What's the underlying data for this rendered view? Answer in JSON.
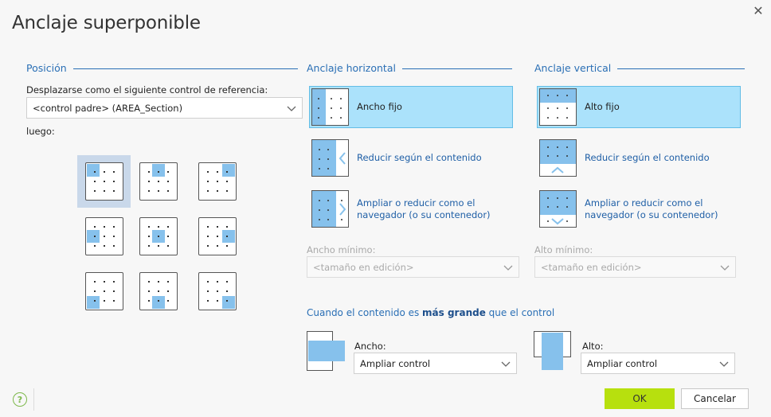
{
  "dialog": {
    "title": "Anclaje superponible",
    "close_symbol": "✕"
  },
  "position": {
    "header": "Posición",
    "ref_label": "Desplazarse como el siguiente control de referencia:",
    "ref_value": "<control padre> (AREA_Section)",
    "then_label": "luego:",
    "selected_index": 0
  },
  "horizontal": {
    "header": "Anclaje horizontal",
    "options": [
      {
        "label": "Ancho fijo",
        "selected": true
      },
      {
        "label": "Reducir según el contenido",
        "selected": false
      },
      {
        "label": "Ampliar o reducir como el navegador (o su contenedor)",
        "selected": false
      }
    ],
    "min_label": "Ancho mínimo:",
    "min_value": "<tamaño en edición>"
  },
  "vertical": {
    "header": "Anclaje vertical",
    "options": [
      {
        "label": "Alto fijo",
        "selected": true
      },
      {
        "label": "Reducir según el contenido",
        "selected": false
      },
      {
        "label": "Ampliar o reducir como el navegador (o su contenedor)",
        "selected": false
      }
    ],
    "min_label": "Alto mínimo:",
    "min_value": "<tamaño en edición>"
  },
  "overflow": {
    "text_before": "Cuando el contenido es ",
    "text_bold": "más grande",
    "text_after": " que el control",
    "width_label": "Ancho:",
    "width_value": "Ampliar control",
    "height_label": "Alto:",
    "height_value": "Ampliar control"
  },
  "footer": {
    "help_symbol": "?",
    "ok_label": "OK",
    "cancel_label": "Cancelar"
  },
  "colors": {
    "accent": "#2a6fb5",
    "selected_bg": "#abe2fb",
    "ok_bg": "#b7e00e",
    "block": "#86c1ec"
  }
}
